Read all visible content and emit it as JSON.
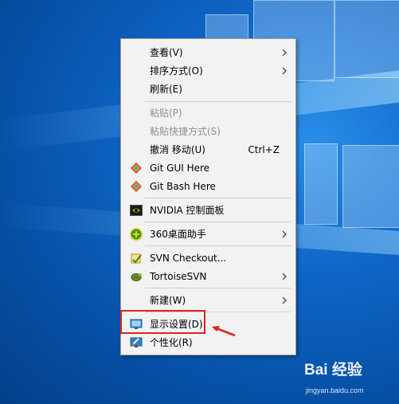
{
  "menu": {
    "items": [
      {
        "label": "查看(V)",
        "has_submenu": true
      },
      {
        "label": "排序方式(O)",
        "has_submenu": true
      },
      {
        "label": "刷新(E)"
      },
      {
        "label": "粘贴(P)",
        "disabled": true
      },
      {
        "label": "粘贴快捷方式(S)",
        "disabled": true
      },
      {
        "label": "撤消 移动(U)",
        "shortcut": "Ctrl+Z"
      },
      {
        "label": "Git GUI Here",
        "icon": "git-icon"
      },
      {
        "label": "Git Bash Here",
        "icon": "git-icon"
      },
      {
        "label": "NVIDIA 控制面板",
        "icon": "nvidia-icon"
      },
      {
        "label": "360桌面助手",
        "icon": "360-icon",
        "has_submenu": true
      },
      {
        "label": "SVN Checkout...",
        "icon": "svn-checkout-icon"
      },
      {
        "label": "TortoiseSVN",
        "icon": "tortoisesvn-icon",
        "has_submenu": true
      },
      {
        "label": "新建(W)",
        "has_submenu": true
      },
      {
        "label": "显示设置(D)",
        "icon": "display-icon"
      },
      {
        "label": "个性化(R)",
        "icon": "personalize-icon"
      }
    ]
  },
  "colors": {
    "annotation_red": "#e0231c",
    "desktop_blue": "#0f66c8",
    "menu_bg": "#f2f2f2"
  },
  "watermark": {
    "logo": "Bai 经验",
    "url": "jingyan.baidu.com"
  }
}
